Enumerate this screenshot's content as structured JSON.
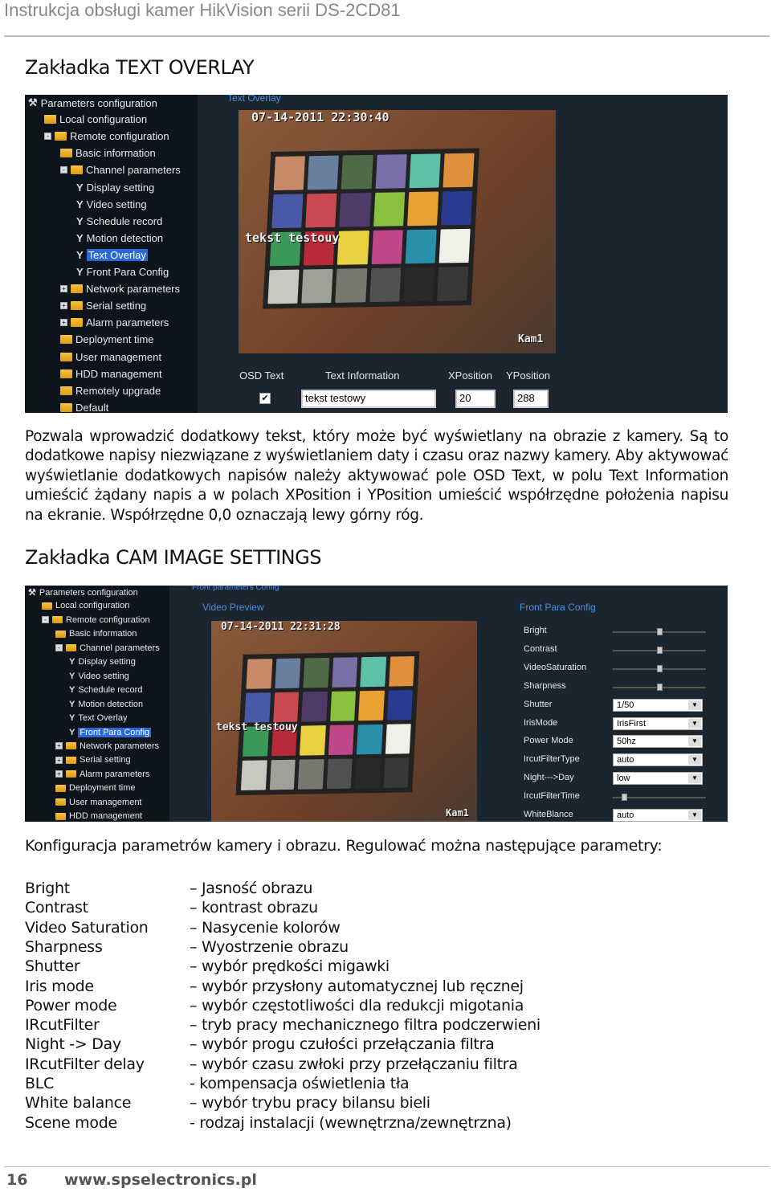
{
  "header": {
    "title": "Instrukcja obsługi kamer HikVision serii DS-2CD81"
  },
  "section1": {
    "title": "Zakładka TEXT OVERLAY",
    "screenshot": {
      "tab_title": "Text Overlay",
      "tree": [
        {
          "label": "Parameters configuration",
          "level": 0,
          "icon": "tools-icon"
        },
        {
          "label": "Local configuration",
          "level": 1,
          "icon": "folder-icon"
        },
        {
          "label": "Remote configuration",
          "level": 1,
          "icon": "folder-icon",
          "toggle": "-"
        },
        {
          "label": "Basic information",
          "level": 2,
          "icon": "folder-icon"
        },
        {
          "label": "Channel parameters",
          "level": 2,
          "icon": "folder-icon",
          "toggle": "-"
        },
        {
          "label": "Display setting",
          "level": 3,
          "icon": "wrench-icon"
        },
        {
          "label": "Video setting",
          "level": 3,
          "icon": "wrench-icon"
        },
        {
          "label": "Schedule record",
          "level": 3,
          "icon": "wrench-icon"
        },
        {
          "label": "Motion detection",
          "level": 3,
          "icon": "wrench-icon"
        },
        {
          "label": "Text Overlay",
          "level": 3,
          "icon": "wrench-icon",
          "selected": true
        },
        {
          "label": "Front Para Config",
          "level": 3,
          "icon": "wrench-icon"
        },
        {
          "label": "Network parameters",
          "level": 2,
          "icon": "folder-icon",
          "toggle": "+"
        },
        {
          "label": "Serial setting",
          "level": 2,
          "icon": "folder-icon",
          "toggle": "+"
        },
        {
          "label": "Alarm parameters",
          "level": 2,
          "icon": "folder-icon",
          "toggle": "+"
        },
        {
          "label": "Deployment time",
          "level": 2,
          "icon": "folder-icon"
        },
        {
          "label": "User management",
          "level": 2,
          "icon": "folder-icon"
        },
        {
          "label": "HDD management",
          "level": 2,
          "icon": "folder-icon"
        },
        {
          "label": "Remotely upgrade",
          "level": 2,
          "icon": "folder-icon"
        },
        {
          "label": "Default",
          "level": 2,
          "icon": "folder-icon"
        }
      ],
      "osd_timestamp": "07-14-2011 22:30:40",
      "osd_text": "tekst testouy",
      "osd_camera_name": "Kam1",
      "columns": {
        "osd_text": "OSD Text",
        "text_information": "Text Information",
        "xposition": "XPosition",
        "yposition": "YPosition"
      },
      "osd_checked": true,
      "text_value": "tekst testowy",
      "x_value": "20",
      "y_value": "288"
    },
    "paragraph": "Pozwala wprowadzić dodatkowy tekst, który może być wyświetlany na obrazie z kamery. Są to dodatkowe napisy niezwiązane z wyświetlaniem daty i czasu oraz nazwy kamery. Aby aktywować wyświetlanie dodatkowych napisów należy aktywować pole OSD Text, w polu Text Information umieścić żądany napis a w polach XPosition i YPosition umieścić współrzędne położenia napisu na ekranie. Współrzędne 0,0 oznaczają lewy górny róg."
  },
  "section2": {
    "title": "Zakładka CAM IMAGE SETTINGS",
    "screenshot": {
      "tab_title": "Front parameters Config",
      "video_preview": "Video Preview",
      "panel_title": "Front Para Config",
      "tree": [
        {
          "label": "Parameters configuration",
          "level": 0,
          "icon": "tools-icon"
        },
        {
          "label": "Local configuration",
          "level": 1,
          "icon": "folder-icon"
        },
        {
          "label": "Remote configuration",
          "level": 1,
          "icon": "folder-icon",
          "toggle": "-"
        },
        {
          "label": "Basic information",
          "level": 2,
          "icon": "folder-icon"
        },
        {
          "label": "Channel parameters",
          "level": 2,
          "icon": "folder-icon",
          "toggle": "-"
        },
        {
          "label": "Display setting",
          "level": 3,
          "icon": "wrench-icon"
        },
        {
          "label": "Video setting",
          "level": 3,
          "icon": "wrench-icon"
        },
        {
          "label": "Schedule record",
          "level": 3,
          "icon": "wrench-icon"
        },
        {
          "label": "Motion detection",
          "level": 3,
          "icon": "wrench-icon"
        },
        {
          "label": "Text Overlay",
          "level": 3,
          "icon": "wrench-icon"
        },
        {
          "label": "Front Para Config",
          "level": 3,
          "icon": "wrench-icon",
          "selected": true
        },
        {
          "label": "Network parameters",
          "level": 2,
          "icon": "folder-icon",
          "toggle": "+"
        },
        {
          "label": "Serial setting",
          "level": 2,
          "icon": "folder-icon",
          "toggle": "+"
        },
        {
          "label": "Alarm parameters",
          "level": 2,
          "icon": "folder-icon",
          "toggle": "+"
        },
        {
          "label": "Deployment time",
          "level": 2,
          "icon": "folder-icon"
        },
        {
          "label": "User management",
          "level": 2,
          "icon": "folder-icon"
        },
        {
          "label": "HDD management",
          "level": 2,
          "icon": "folder-icon"
        }
      ],
      "osd_timestamp": "07-14-2011 22:31:28",
      "osd_text": "tekst testouy",
      "osd_camera_name": "Kam1",
      "params": [
        {
          "label": "Bright",
          "type": "slider",
          "value": 0.5
        },
        {
          "label": "Contrast",
          "type": "slider",
          "value": 0.5
        },
        {
          "label": "VideoSaturation",
          "type": "slider",
          "value": 0.5
        },
        {
          "label": "Sharpness",
          "type": "slider",
          "value": 0.5
        },
        {
          "label": "Shutter",
          "type": "select",
          "value": "1/50"
        },
        {
          "label": "IrisMode",
          "type": "select",
          "value": "IrisFirst"
        },
        {
          "label": "Power Mode",
          "type": "select",
          "value": "50hz"
        },
        {
          "label": "IrcutFilterType",
          "type": "select",
          "value": "auto"
        },
        {
          "label": "Night--->Day",
          "type": "select",
          "value": "low"
        },
        {
          "label": "IrcutFilterTime",
          "type": "slider",
          "value": 0.12
        },
        {
          "label": "WhiteBlance",
          "type": "select",
          "value": "auto"
        }
      ]
    },
    "intro": "Konfiguracja parametrów kamery i obrazu. Regulować można następujące parametry:",
    "parameters": [
      {
        "name": "Bright",
        "desc": "– Jasność obrazu"
      },
      {
        "name": "Contrast",
        "desc": "– kontrast obrazu"
      },
      {
        "name": "Video Saturation",
        "desc": "– Nasycenie kolorów"
      },
      {
        "name": "Sharpness",
        "desc": "– Wyostrzenie obrazu"
      },
      {
        "name": "Shutter",
        "desc": "– wybór prędkości migawki"
      },
      {
        "name": "Iris mode",
        "desc": "– wybór przysłony automatycznej lub ręcznej"
      },
      {
        "name": "Power mode",
        "desc": "– wybór częstotliwości dla redukcji migotania"
      },
      {
        "name": "IRcutFilter",
        "desc": "– tryb pracy mechanicznego filtra podczerwieni"
      },
      {
        "name": "Night -> Day",
        "desc": "– wybór progu czułości przełączania filtra"
      },
      {
        "name": "IRcutFilter delay",
        "desc": "– wybór czasu zwłoki przy przełączaniu filtra"
      },
      {
        "name": "BLC",
        "desc": "- kompensacja oświetlenia tła"
      },
      {
        "name": "White balance",
        "desc": "– wybór trybu pracy bilansu bieli"
      },
      {
        "name": "Scene mode",
        "desc": "- rodzaj instalacji (wewnętrzna/zewnętrzna)"
      }
    ]
  },
  "footer": {
    "page": "16",
    "url": "www.spselectronics.pl"
  },
  "colors": {
    "panel_bg": "#1b2530",
    "tree_bg": "#0d141c",
    "selection": "#2a6ad8",
    "link_blue": "#4a8fe0",
    "checker": [
      "#c98a6a",
      "#6a7fa0",
      "#4f6a48",
      "#7a70a8",
      "#5ec0a8",
      "#e0903a",
      "#4a58a8",
      "#c84a50",
      "#503a68",
      "#8ac040",
      "#e8a030",
      "#2a3a90",
      "#3a9858",
      "#b82a38",
      "#e8d040",
      "#c04888",
      "#2890a8",
      "#f0f0e8",
      "#c8c8c0",
      "#a0a098",
      "#787870",
      "#505050",
      "#282828",
      "#383838"
    ]
  }
}
